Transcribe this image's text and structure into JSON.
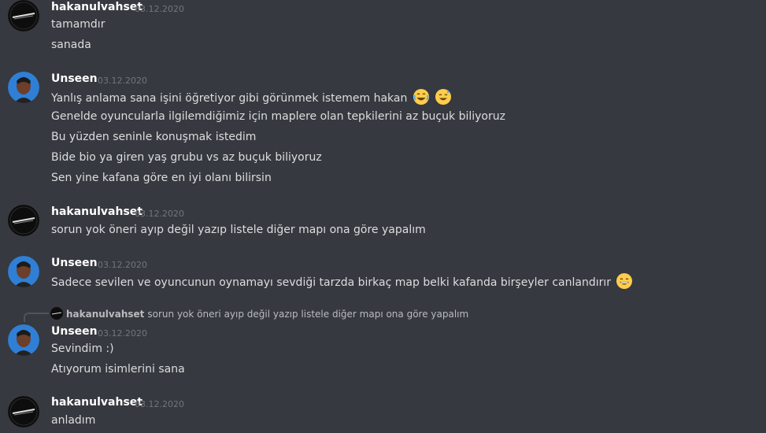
{
  "messages": [
    {
      "author": "hakanulvahset",
      "timestamp": "03.12.2020",
      "avatar": "gezeli-logo-avatar",
      "lines": [
        "tamamdır",
        "sanada"
      ]
    },
    {
      "author": "Unseen",
      "timestamp": "03.12.2020",
      "avatar": "user-photo-avatar",
      "lines": [
        "Yanlış anlama sana işini öğretiyor gibi görünmek istemem hakan",
        "Genelde oyuncularla ilgilemdiğimiz için maplere olan tepkilerini az buçuk biliyoruz",
        "Bu yüzden seninle konuşmak istedim",
        "Bide bio ya giren yaş grubu vs az buçuk biliyoruz",
        "Sen yine kafana göre en iyi olanı bilirsin"
      ],
      "emojis": [
        "joy-emoji",
        "sweat-smile-emoji"
      ]
    },
    {
      "author": "hakanulvahset",
      "timestamp": "03.12.2020",
      "avatar": "gezeli-logo-avatar",
      "lines": [
        "sorun yok öneri ayıp değil yazıp listele diğer mapı ona göre yapalım"
      ]
    },
    {
      "author": "Unseen",
      "timestamp": "03.12.2020",
      "avatar": "user-photo-avatar",
      "lines": [
        "Sadece sevilen ve oyuncunun oynamayı sevdiği tarzda birkaç map belki kafanda birşeyler canlandırır"
      ],
      "emojis": [
        "grin-emoji"
      ]
    },
    {
      "reply_to": {
        "author": "hakanulvahset",
        "text": "sorun yok öneri ayıp değil yazıp listele diğer mapı ona göre yapalım"
      },
      "author": "Unseen",
      "timestamp": "03.12.2020",
      "avatar": "user-photo-avatar",
      "lines": [
        "Sevindim :)",
        "Atıyorum isimlerini sana"
      ]
    },
    {
      "author": "hakanulvahset",
      "timestamp": "03.12.2020",
      "avatar": "gezeli-logo-avatar",
      "lines": [
        "anladım"
      ]
    }
  ],
  "colors": {
    "background": "#36393f",
    "username": "#ffffff",
    "text": "#dcddde",
    "timestamp": "#72767d"
  }
}
